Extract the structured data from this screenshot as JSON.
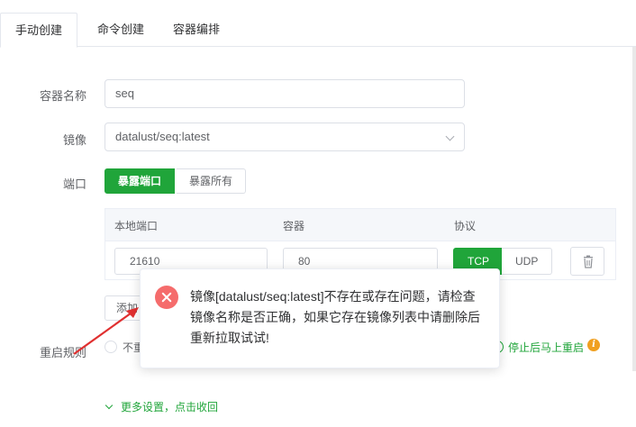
{
  "tabs": [
    "手动创建",
    "命令创建",
    "容器编排"
  ],
  "form": {
    "name_label": "容器名称",
    "name_value": "seq",
    "image_label": "镜像",
    "image_value": "datalust/seq:latest",
    "port_label": "端口",
    "expose_options": [
      "暴露端口",
      "暴露所有"
    ],
    "port_table": {
      "headers": [
        "本地端口",
        "容器",
        "协议"
      ],
      "rows": [
        {
          "local": "21610",
          "container": "80",
          "protocols": [
            "TCP",
            "UDP"
          ],
          "selected": "TCP"
        }
      ]
    },
    "add_label": "添加",
    "restart_label": "重启规则",
    "restart_first_option": "不重",
    "restart_selected_option": "停止后马上重启",
    "more_settings": "更多设置，点击收回"
  },
  "error_toast": {
    "message": "镜像[datalust/seq:latest]不存在或存在问题，请检查镜像名称是否正确，如果它存在镜像列表中请删除后重新拉取试试!"
  },
  "colors": {
    "accent": "#20a53a",
    "error": "#f56c6c",
    "warning": "#f0a020"
  }
}
